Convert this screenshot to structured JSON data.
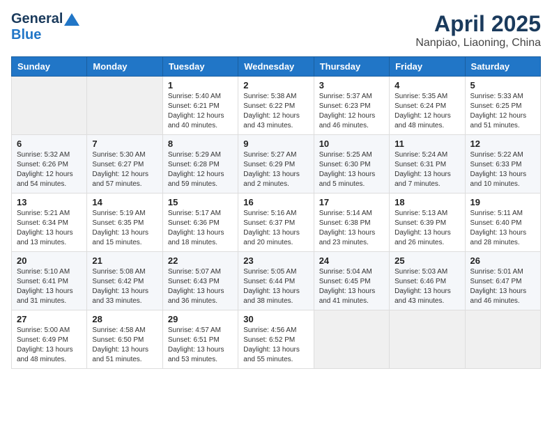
{
  "logo": {
    "general": "General",
    "blue": "Blue"
  },
  "header": {
    "month": "April 2025",
    "location": "Nanpiao, Liaoning, China"
  },
  "days_of_week": [
    "Sunday",
    "Monday",
    "Tuesday",
    "Wednesday",
    "Thursday",
    "Friday",
    "Saturday"
  ],
  "weeks": [
    [
      {
        "day": "",
        "sunrise": "",
        "sunset": "",
        "daylight": ""
      },
      {
        "day": "",
        "sunrise": "",
        "sunset": "",
        "daylight": ""
      },
      {
        "day": "1",
        "sunrise": "Sunrise: 5:40 AM",
        "sunset": "Sunset: 6:21 PM",
        "daylight": "Daylight: 12 hours and 40 minutes."
      },
      {
        "day": "2",
        "sunrise": "Sunrise: 5:38 AM",
        "sunset": "Sunset: 6:22 PM",
        "daylight": "Daylight: 12 hours and 43 minutes."
      },
      {
        "day": "3",
        "sunrise": "Sunrise: 5:37 AM",
        "sunset": "Sunset: 6:23 PM",
        "daylight": "Daylight: 12 hours and 46 minutes."
      },
      {
        "day": "4",
        "sunrise": "Sunrise: 5:35 AM",
        "sunset": "Sunset: 6:24 PM",
        "daylight": "Daylight: 12 hours and 48 minutes."
      },
      {
        "day": "5",
        "sunrise": "Sunrise: 5:33 AM",
        "sunset": "Sunset: 6:25 PM",
        "daylight": "Daylight: 12 hours and 51 minutes."
      }
    ],
    [
      {
        "day": "6",
        "sunrise": "Sunrise: 5:32 AM",
        "sunset": "Sunset: 6:26 PM",
        "daylight": "Daylight: 12 hours and 54 minutes."
      },
      {
        "day": "7",
        "sunrise": "Sunrise: 5:30 AM",
        "sunset": "Sunset: 6:27 PM",
        "daylight": "Daylight: 12 hours and 57 minutes."
      },
      {
        "day": "8",
        "sunrise": "Sunrise: 5:29 AM",
        "sunset": "Sunset: 6:28 PM",
        "daylight": "Daylight: 12 hours and 59 minutes."
      },
      {
        "day": "9",
        "sunrise": "Sunrise: 5:27 AM",
        "sunset": "Sunset: 6:29 PM",
        "daylight": "Daylight: 13 hours and 2 minutes."
      },
      {
        "day": "10",
        "sunrise": "Sunrise: 5:25 AM",
        "sunset": "Sunset: 6:30 PM",
        "daylight": "Daylight: 13 hours and 5 minutes."
      },
      {
        "day": "11",
        "sunrise": "Sunrise: 5:24 AM",
        "sunset": "Sunset: 6:31 PM",
        "daylight": "Daylight: 13 hours and 7 minutes."
      },
      {
        "day": "12",
        "sunrise": "Sunrise: 5:22 AM",
        "sunset": "Sunset: 6:33 PM",
        "daylight": "Daylight: 13 hours and 10 minutes."
      }
    ],
    [
      {
        "day": "13",
        "sunrise": "Sunrise: 5:21 AM",
        "sunset": "Sunset: 6:34 PM",
        "daylight": "Daylight: 13 hours and 13 minutes."
      },
      {
        "day": "14",
        "sunrise": "Sunrise: 5:19 AM",
        "sunset": "Sunset: 6:35 PM",
        "daylight": "Daylight: 13 hours and 15 minutes."
      },
      {
        "day": "15",
        "sunrise": "Sunrise: 5:17 AM",
        "sunset": "Sunset: 6:36 PM",
        "daylight": "Daylight: 13 hours and 18 minutes."
      },
      {
        "day": "16",
        "sunrise": "Sunrise: 5:16 AM",
        "sunset": "Sunset: 6:37 PM",
        "daylight": "Daylight: 13 hours and 20 minutes."
      },
      {
        "day": "17",
        "sunrise": "Sunrise: 5:14 AM",
        "sunset": "Sunset: 6:38 PM",
        "daylight": "Daylight: 13 hours and 23 minutes."
      },
      {
        "day": "18",
        "sunrise": "Sunrise: 5:13 AM",
        "sunset": "Sunset: 6:39 PM",
        "daylight": "Daylight: 13 hours and 26 minutes."
      },
      {
        "day": "19",
        "sunrise": "Sunrise: 5:11 AM",
        "sunset": "Sunset: 6:40 PM",
        "daylight": "Daylight: 13 hours and 28 minutes."
      }
    ],
    [
      {
        "day": "20",
        "sunrise": "Sunrise: 5:10 AM",
        "sunset": "Sunset: 6:41 PM",
        "daylight": "Daylight: 13 hours and 31 minutes."
      },
      {
        "day": "21",
        "sunrise": "Sunrise: 5:08 AM",
        "sunset": "Sunset: 6:42 PM",
        "daylight": "Daylight: 13 hours and 33 minutes."
      },
      {
        "day": "22",
        "sunrise": "Sunrise: 5:07 AM",
        "sunset": "Sunset: 6:43 PM",
        "daylight": "Daylight: 13 hours and 36 minutes."
      },
      {
        "day": "23",
        "sunrise": "Sunrise: 5:05 AM",
        "sunset": "Sunset: 6:44 PM",
        "daylight": "Daylight: 13 hours and 38 minutes."
      },
      {
        "day": "24",
        "sunrise": "Sunrise: 5:04 AM",
        "sunset": "Sunset: 6:45 PM",
        "daylight": "Daylight: 13 hours and 41 minutes."
      },
      {
        "day": "25",
        "sunrise": "Sunrise: 5:03 AM",
        "sunset": "Sunset: 6:46 PM",
        "daylight": "Daylight: 13 hours and 43 minutes."
      },
      {
        "day": "26",
        "sunrise": "Sunrise: 5:01 AM",
        "sunset": "Sunset: 6:47 PM",
        "daylight": "Daylight: 13 hours and 46 minutes."
      }
    ],
    [
      {
        "day": "27",
        "sunrise": "Sunrise: 5:00 AM",
        "sunset": "Sunset: 6:49 PM",
        "daylight": "Daylight: 13 hours and 48 minutes."
      },
      {
        "day": "28",
        "sunrise": "Sunrise: 4:58 AM",
        "sunset": "Sunset: 6:50 PM",
        "daylight": "Daylight: 13 hours and 51 minutes."
      },
      {
        "day": "29",
        "sunrise": "Sunrise: 4:57 AM",
        "sunset": "Sunset: 6:51 PM",
        "daylight": "Daylight: 13 hours and 53 minutes."
      },
      {
        "day": "30",
        "sunrise": "Sunrise: 4:56 AM",
        "sunset": "Sunset: 6:52 PM",
        "daylight": "Daylight: 13 hours and 55 minutes."
      },
      {
        "day": "",
        "sunrise": "",
        "sunset": "",
        "daylight": ""
      },
      {
        "day": "",
        "sunrise": "",
        "sunset": "",
        "daylight": ""
      },
      {
        "day": "",
        "sunrise": "",
        "sunset": "",
        "daylight": ""
      }
    ]
  ]
}
